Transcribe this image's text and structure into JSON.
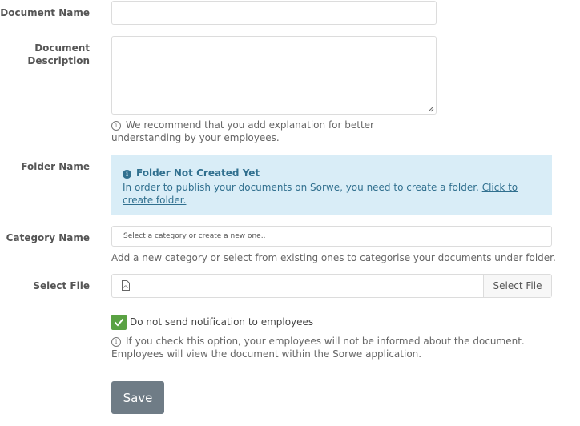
{
  "form": {
    "document_name": {
      "label": "Document Name",
      "value": "",
      "placeholder": ""
    },
    "document_description": {
      "label": "Document Description",
      "value": "",
      "help": "We recommend that you add explanation for better understanding by your employees."
    },
    "folder": {
      "label": "Folder Name",
      "alert_title": "Folder Not Created Yet",
      "alert_text": "In order to publish your documents on Sorwe, you need to create a folder.",
      "alert_link": "Click to create folder."
    },
    "category": {
      "label": "Category Name",
      "placeholder": "Select a category or create a new one..",
      "help": "Add a new category or select from existing ones to categorise your documents under folder."
    },
    "file": {
      "label": "Select File",
      "button": "Select File",
      "file_icon": "pdf-file-icon"
    },
    "notification": {
      "checked": true,
      "label": "Do not send notification to employees",
      "help": "If you check this option, your employees will not be informed about the document. Employees will view the document within the Sorwe application."
    },
    "save_label": "Save"
  },
  "colors": {
    "alert_bg": "#d9edf7",
    "alert_text": "#31708f",
    "checkbox": "#5aa243",
    "save_button": "#6f7c86"
  }
}
